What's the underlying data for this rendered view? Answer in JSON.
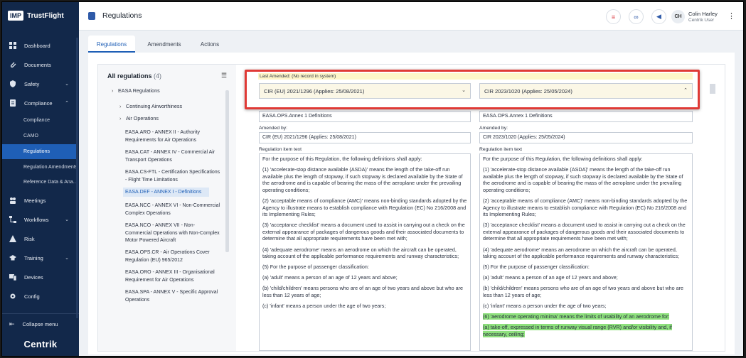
{
  "app": {
    "logo_badge": "IMP",
    "logo_name": "TrustFlight",
    "brand_footer": "Centrik"
  },
  "sidebar": {
    "items": [
      {
        "label": "Dashboard",
        "icon": "grid-icon"
      },
      {
        "label": "Documents",
        "icon": "paperclip-icon"
      },
      {
        "label": "Safety",
        "icon": "shield-icon"
      },
      {
        "label": "Compliance",
        "icon": "compliance-icon"
      },
      {
        "label": "Meetings",
        "icon": "meetings-icon"
      },
      {
        "label": "Workflows",
        "icon": "workflow-icon"
      },
      {
        "label": "Risk",
        "icon": "risk-icon"
      },
      {
        "label": "Training",
        "icon": "graduation-cap-icon"
      },
      {
        "label": "Devices",
        "icon": "devices-icon"
      },
      {
        "label": "Config",
        "icon": "config-icon"
      }
    ],
    "compliance_sub": [
      "Compliance",
      "CAMO",
      "Regulations",
      "Regulation Amendments",
      "Reference Data & Ana..."
    ],
    "collapse_label": "Collapse menu"
  },
  "header": {
    "title": "Regulations",
    "user_initials": "CH",
    "user_name": "Colin Harley",
    "user_role": "Centrik User"
  },
  "tabs": [
    "Regulations",
    "Amendments",
    "Actions"
  ],
  "tree": {
    "title": "All regulations",
    "count": "(4)",
    "root": "EASA Regulations",
    "groups": [
      "Continuing Airworthiness",
      "Air Operations"
    ],
    "leaves": [
      "EASA.ARO - ANNEX II - Authority Requirements for Air Operations",
      "EASA.CAT - ANNEX IV - Commercial Air Transport Operations",
      "EASA.CS-FTL - Certification Specifications - Flight Time Limitations",
      "EASA.DEF - ANNEX I - Definitions",
      "EASA.NCC - ANNEX VI - Non-Commercial Complex Operations",
      "EASA.NCO - ANNEX VII - Non-Commercial Operations with Non-Complex Motor Powered Aircraft",
      "EASA.OPS.CR - Air Operations Cover Regulation (EU) 965/2012",
      "EASA.ORO - ANNEX III - Organisational Requirement for Air Operations",
      "EASA.SPA - ANNEX V - Specific Approval Operations"
    ]
  },
  "compare": {
    "last_amended": "Last Amended: (No record in system)",
    "left": {
      "version": "CIR (EU) 2021/1296 (Applies: 25/08/2021)",
      "item": "EASA.OPS.Annex 1 Definitions",
      "amended_label": "Amended by:",
      "amended_by": "CIR (EU) 2021/1296  (Applies: 25/08/2021)",
      "text_label": "Regulation item text"
    },
    "right": {
      "version": "CIR 2023/1020 (Applies: 25/05/2024)",
      "item": "EASA.OPS.Annex 1 Definitions",
      "amended_label": "Amended by:",
      "amended_by": "CIR 2023/1020  (Applies: 25/05/2024)",
      "text_label": "Regulation item text"
    },
    "paragraphs": [
      "For the purpose of this Regulation, the following definitions shall apply:",
      "(1)   'accelerate-stop distance available (ASDA)' means the length of the take-off run available plus the length of stopway, if such stopway is declared available by the State of the aerodrome and is capable of bearing the mass of the aeroplane under the prevailing operating conditions;",
      "(2)   'acceptable means of compliance (AMC)' means non-binding standards adopted by the Agency to illustrate means to establish compliance with Regulation (EC) No 216/2008 and its Implementing Rules;",
      "(3)   'acceptance checklist' means a document used to assist in carrying out a check on the external appearance of packages of dangerous goods and their associated documents to determine that all appropriate requirements have been met with;",
      "(4)   'adequate aerodrome' means an aerodrome on which the aircraft can be operated, taking account of the applicable performance requirements and runway characteristics;",
      "(5)    For the purpose of passenger classification:",
      "(a)   'adult' means a person of an age of 12 years and above;",
      "(b)   'child/children' means persons who are of an age of two years and above but who are less than 12 years of age;",
      "(c)   'infant' means a person under the age of two years;"
    ],
    "added": [
      "(6) 'aerodrome operating minima' means the limits of usability of an aerodrome for:",
      "(a) take-off, expressed in terms of runway visual range (RVR) and/or visibility and, if necessary, ceiling;"
    ]
  }
}
